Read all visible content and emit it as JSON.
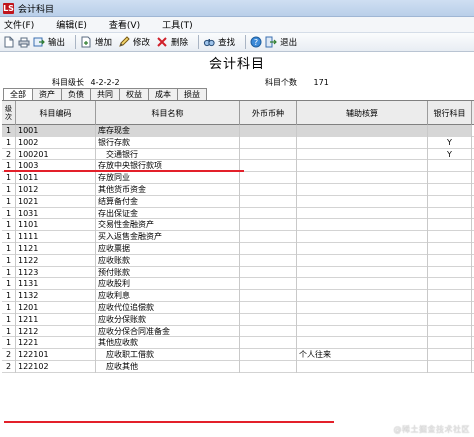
{
  "window": {
    "logo": "LS",
    "title": "会计科目"
  },
  "menu": [
    "文件(F)",
    "编辑(E)",
    "查看(V)",
    "工具(T)"
  ],
  "toolbar": {
    "output": "输出",
    "add": "增加",
    "edit": "修改",
    "delete": "删除",
    "find": "查找",
    "exit": "退出"
  },
  "page": {
    "title": "会计科目",
    "level_label": "科目级长",
    "level_value": "4-2-2-2",
    "count_label": "科目个数",
    "count_value": "171"
  },
  "tabs": [
    "全部",
    "资产",
    "负债",
    "共同",
    "权益",
    "成本",
    "损益"
  ],
  "table": {
    "headers": {
      "level_1": "级",
      "level_2": "次",
      "code": "科目编码",
      "name": "科目名称",
      "currency": "外币币种",
      "aux": "辅助核算",
      "bank": "银行科目"
    },
    "rows": [
      {
        "level": "1",
        "code": "1001",
        "name": "库存现金",
        "currency": "",
        "aux": "",
        "bank": "",
        "selected": true
      },
      {
        "level": "1",
        "code": "1002",
        "name": "银行存款",
        "currency": "",
        "aux": "",
        "bank": "Y"
      },
      {
        "level": "2",
        "code": "100201",
        "name": "交通银行",
        "currency": "",
        "aux": "",
        "bank": "Y",
        "indent": true
      },
      {
        "level": "1",
        "code": "1003",
        "name": "存放中央银行款项",
        "currency": "",
        "aux": "",
        "bank": ""
      },
      {
        "level": "1",
        "code": "1011",
        "name": "存放同业",
        "currency": "",
        "aux": "",
        "bank": ""
      },
      {
        "level": "1",
        "code": "1012",
        "name": "其他货币资金",
        "currency": "",
        "aux": "",
        "bank": ""
      },
      {
        "level": "1",
        "code": "1021",
        "name": "结算备付金",
        "currency": "",
        "aux": "",
        "bank": ""
      },
      {
        "level": "1",
        "code": "1031",
        "name": "存出保证金",
        "currency": "",
        "aux": "",
        "bank": ""
      },
      {
        "level": "1",
        "code": "1101",
        "name": "交易性金融资产",
        "currency": "",
        "aux": "",
        "bank": ""
      },
      {
        "level": "1",
        "code": "1111",
        "name": "买入返售金融资产",
        "currency": "",
        "aux": "",
        "bank": ""
      },
      {
        "level": "1",
        "code": "1121",
        "name": "应收票据",
        "currency": "",
        "aux": "",
        "bank": ""
      },
      {
        "level": "1",
        "code": "1122",
        "name": "应收账款",
        "currency": "",
        "aux": "",
        "bank": ""
      },
      {
        "level": "1",
        "code": "1123",
        "name": "预付账款",
        "currency": "",
        "aux": "",
        "bank": ""
      },
      {
        "level": "1",
        "code": "1131",
        "name": "应收股利",
        "currency": "",
        "aux": "",
        "bank": ""
      },
      {
        "level": "1",
        "code": "1132",
        "name": "应收利息",
        "currency": "",
        "aux": "",
        "bank": ""
      },
      {
        "level": "1",
        "code": "1201",
        "name": "应收代位追偿款",
        "currency": "",
        "aux": "",
        "bank": ""
      },
      {
        "level": "1",
        "code": "1211",
        "name": "应收分保账款",
        "currency": "",
        "aux": "",
        "bank": ""
      },
      {
        "level": "1",
        "code": "1212",
        "name": "应收分保合同准备金",
        "currency": "",
        "aux": "",
        "bank": ""
      },
      {
        "level": "1",
        "code": "1221",
        "name": "其他应收款",
        "currency": "",
        "aux": "",
        "bank": ""
      },
      {
        "level": "2",
        "code": "122101",
        "name": "应收职工借款",
        "currency": "",
        "aux": "个人往来",
        "bank": "",
        "indent": true
      },
      {
        "level": "2",
        "code": "122102",
        "name": "应收其他",
        "currency": "",
        "aux": "",
        "bank": "",
        "indent": true
      }
    ]
  },
  "watermark": "@稀土掘金技术社区",
  "colors": {
    "title_bar": "#b9cfe9",
    "highlight_underline": "#e3202a",
    "selected_row": "#d6d6d6"
  },
  "icons": [
    "app-logo",
    "new-icon",
    "print-icon",
    "output-icon",
    "add-icon",
    "edit-icon",
    "delete-icon",
    "find-icon",
    "help-icon",
    "exit-icon"
  ]
}
